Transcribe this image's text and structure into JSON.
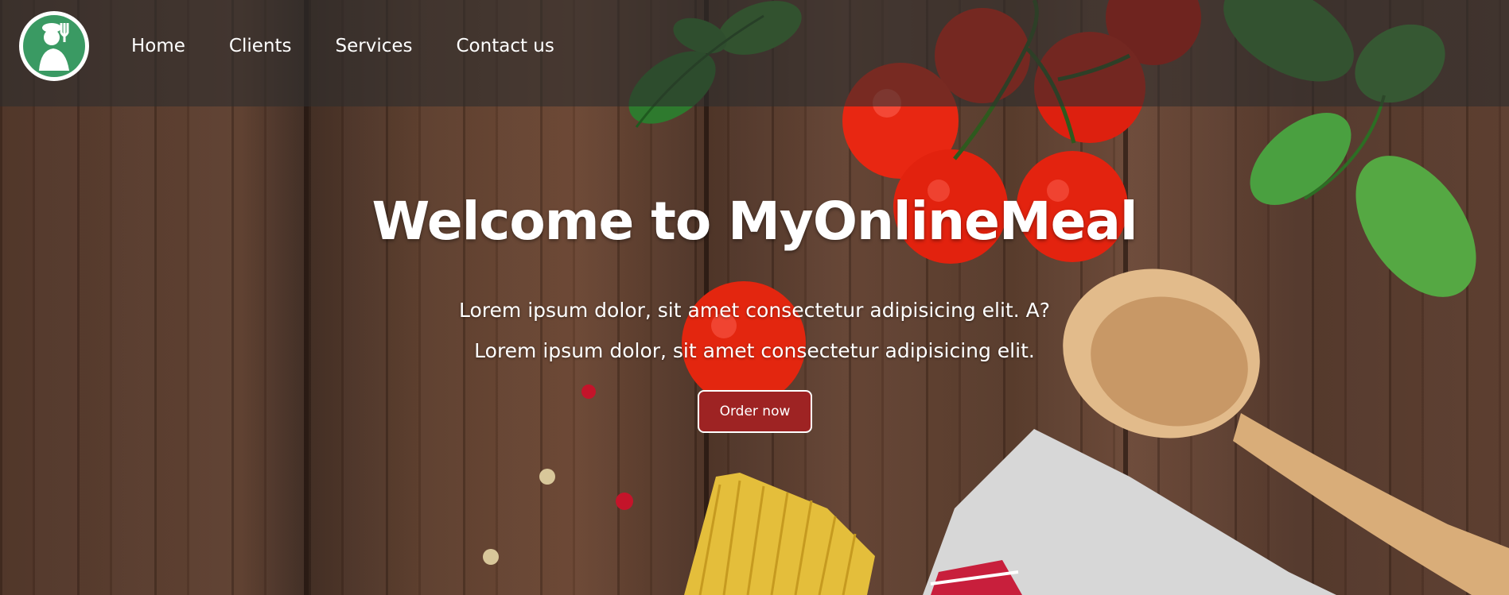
{
  "header": {
    "logo_icon": "chef-logo-icon",
    "nav": [
      {
        "label": "Home"
      },
      {
        "label": "Clients"
      },
      {
        "label": "Services"
      },
      {
        "label": "Contact us"
      }
    ]
  },
  "hero": {
    "title": "Welcome to MyOnlineMeal",
    "line1": "Lorem ipsum dolor, sit amet consectetur adipisicing elit. A?",
    "line2": "Lorem ipsum dolor, sit amet consectetur adipisicing elit.",
    "cta_label": "Order now"
  },
  "colors": {
    "cta_background": "#9e2323",
    "logo_green": "#3a9a63",
    "header_overlay": "rgba(45,45,45,0.6)"
  }
}
